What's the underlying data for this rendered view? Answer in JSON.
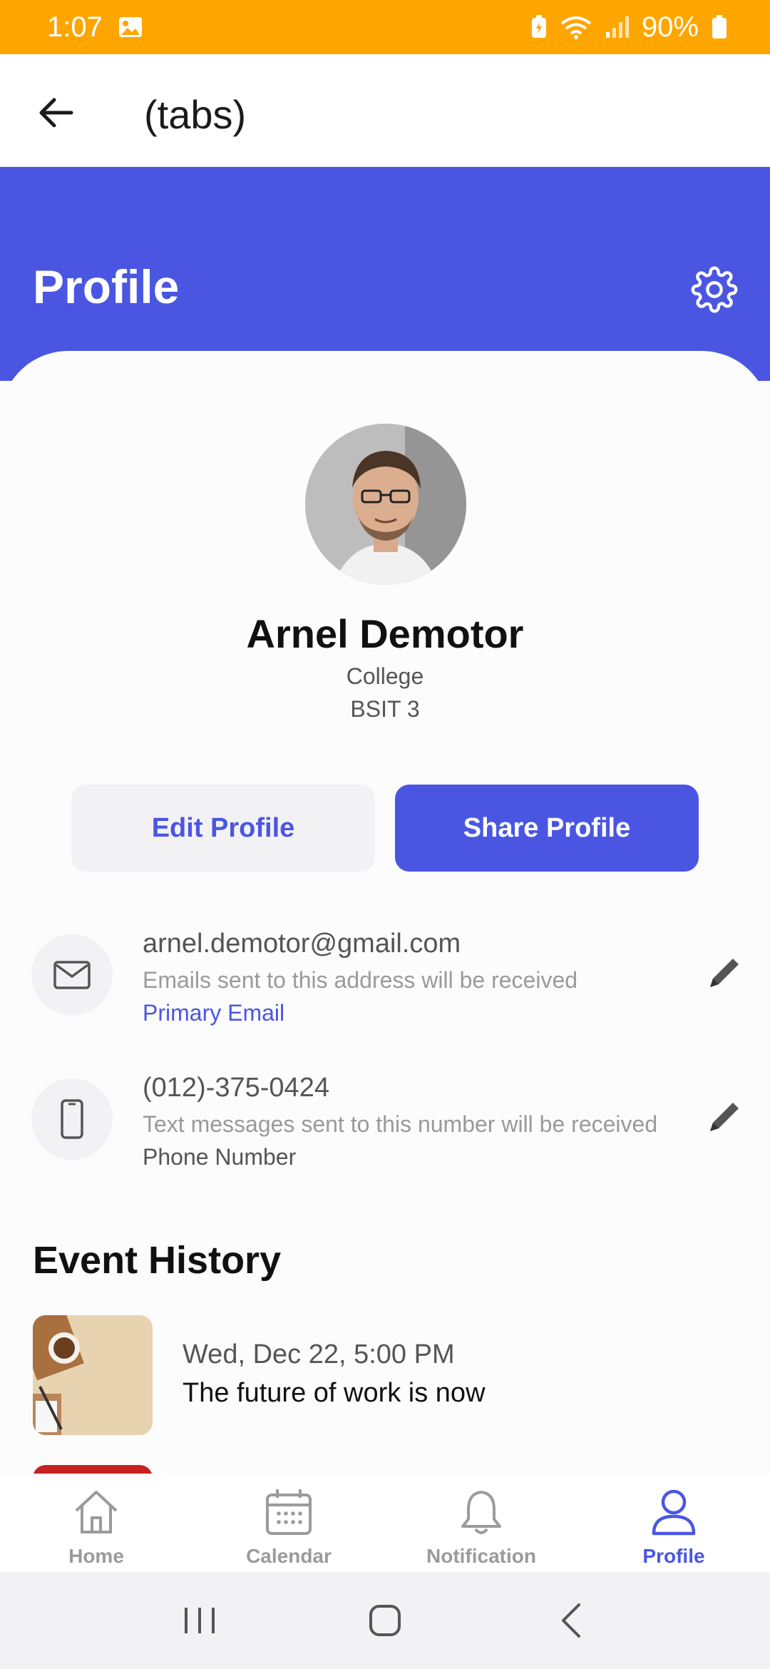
{
  "status_bar": {
    "time": "1:07",
    "battery": "90%"
  },
  "app_bar": {
    "title": "(tabs)"
  },
  "header": {
    "title": "Profile"
  },
  "profile": {
    "name": "Arnel Demotor",
    "department": "College",
    "course": "BSIT 3"
  },
  "actions": {
    "edit_label": "Edit Profile",
    "share_label": "Share Profile"
  },
  "contacts": [
    {
      "value": "arnel.demotor@gmail.com",
      "description": "Emails sent to this address will be received",
      "tag": "Primary Email",
      "tag_color": "#4A56E2",
      "icon": "mail-icon"
    },
    {
      "value": "(012)-375-0424",
      "description": "Text messages sent to this number will be received",
      "tag": "Phone Number",
      "tag_color": "#555555",
      "icon": "phone-icon"
    }
  ],
  "event_history": {
    "title": "Event History",
    "items": [
      {
        "date": "Wed, Dec 22, 5:00 PM",
        "title": "The future of work is now"
      }
    ]
  },
  "bottom_nav": [
    {
      "label": "Home",
      "icon": "home-icon",
      "active": false
    },
    {
      "label": "Calendar",
      "icon": "calendar-icon",
      "active": false
    },
    {
      "label": "Notification",
      "icon": "bell-icon",
      "active": false
    },
    {
      "label": "Profile",
      "icon": "user-icon",
      "active": true
    }
  ],
  "colors": {
    "status_bar": "#FFA500",
    "accent": "#4A56E2",
    "muted": "#9B9B9B"
  }
}
